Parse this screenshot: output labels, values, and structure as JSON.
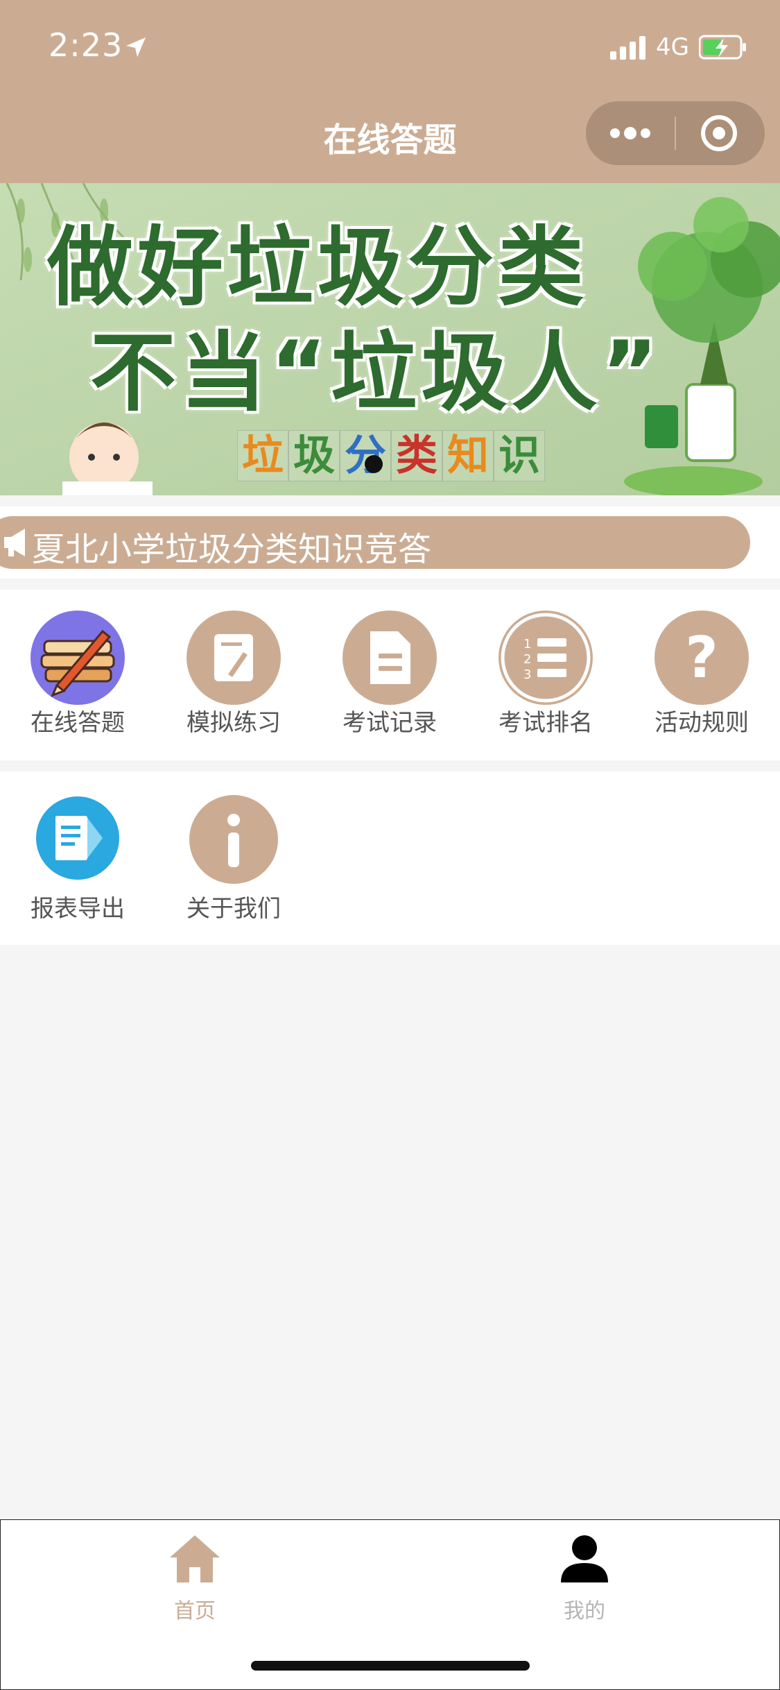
{
  "status_bar": {
    "time": "2:23",
    "network": "4G"
  },
  "nav": {
    "title": "在线答题"
  },
  "banner": {
    "headline_line1": "做好垃圾分类",
    "headline_line2": "不当“垃圾人”",
    "sub_chars": [
      "垃",
      "圾",
      "分",
      "类",
      "知",
      "识"
    ],
    "sub_colors": [
      "#e88a1e",
      "#3b8c3b",
      "#2f6fc4",
      "#c8332b",
      "#e88a1e",
      "#3b8c3b"
    ]
  },
  "notice": {
    "text": "夏北小学垃圾分类知识竞答"
  },
  "grid": {
    "row1": [
      {
        "label": "在线答题",
        "icon": "books-pencil-icon"
      },
      {
        "label": "模拟练习",
        "icon": "edit-document-icon"
      },
      {
        "label": "考试记录",
        "icon": "document-icon"
      },
      {
        "label": "考试排名",
        "icon": "ranking-list-icon"
      },
      {
        "label": "活动规则",
        "icon": "question-mark-icon"
      }
    ],
    "row2": [
      {
        "label": "报表导出",
        "icon": "report-export-icon"
      },
      {
        "label": "关于我们",
        "icon": "info-icon"
      }
    ]
  },
  "tabbar": {
    "items": [
      {
        "label": "首页",
        "icon": "home-icon",
        "active": true
      },
      {
        "label": "我的",
        "icon": "user-icon",
        "active": false
      }
    ]
  },
  "colors": {
    "brand": "#cbac93",
    "active_tab_label": "#cbac93",
    "inactive_tab_label": "#b4b4b4"
  }
}
